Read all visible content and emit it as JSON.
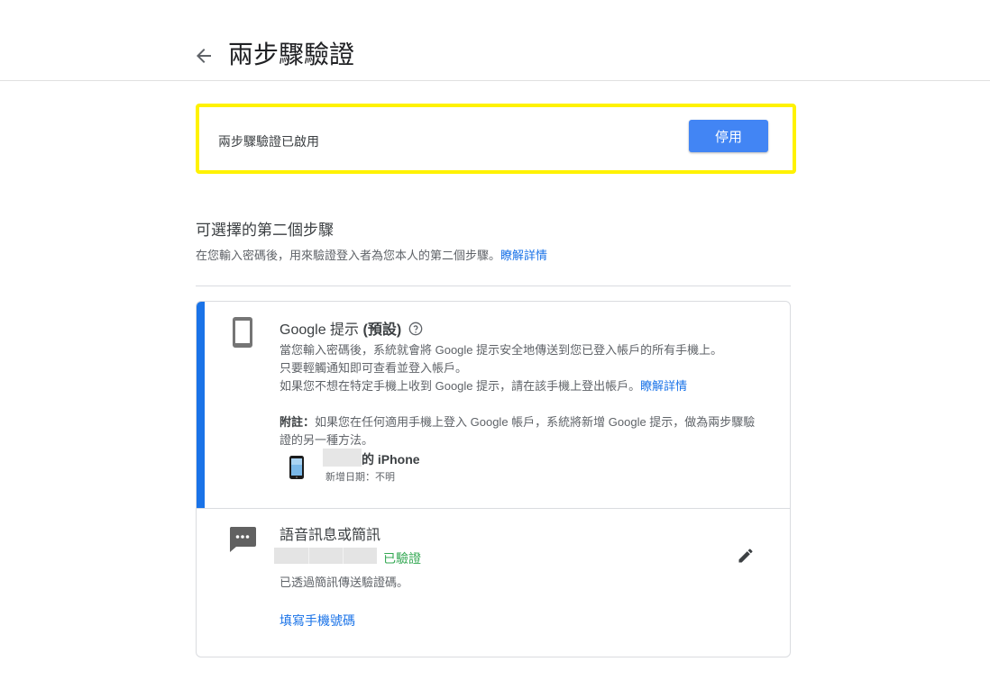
{
  "header": {
    "title": "兩步驟驗證"
  },
  "status": {
    "text": "兩步驟驗證已啟用",
    "disable_label": "停用"
  },
  "section": {
    "title": "可選擇的第二個步驟",
    "desc": "在您輸入密碼後，用來驗證登入者為您本人的第二個步驟。",
    "learn_more": "瞭解詳情"
  },
  "google_prompt": {
    "title_prefix": "Google 提示 ",
    "title_bold": "(預設)",
    "line1": "當您輸入密碼後，系統就會將 Google 提示安全地傳送到您已登入帳戶的所有手機上。",
    "line2": "只要輕觸通知即可查看並登入帳戶。",
    "line3": "如果您不想在特定手機上收到 Google 提示，請在該手機上登出帳戶。",
    "learn_more": "瞭解詳情",
    "note_label": "附註：",
    "note_text": "如果您在任何適用手機上登入 Google 帳戶，系統將新增 Google 提示，做為兩步驟驗證的另一種方法。",
    "device_name": "的 iPhone",
    "device_date": "新增日期：不明"
  },
  "voice_sms": {
    "title": "語音訊息或簡訊",
    "verified": "已驗證",
    "desc": "已透過簡訊傳送驗證碼。",
    "add_phone": "填寫手機號碼"
  },
  "colors": {
    "accent": "#1a73e8",
    "button": "#4285f4",
    "highlight": "#fff200",
    "verified": "#34a853"
  },
  "icons": [
    "back-arrow-icon",
    "phone-icon",
    "help-icon",
    "iphone-icon",
    "sms-icon",
    "edit-pencil-icon"
  ]
}
